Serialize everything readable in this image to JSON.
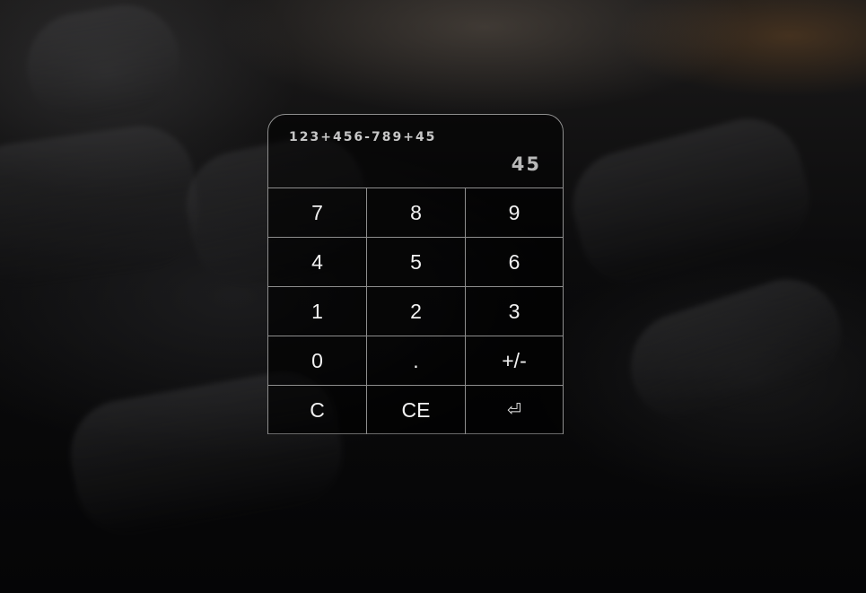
{
  "display": {
    "expression": "123+456-789+45",
    "result": "45"
  },
  "keypad": {
    "rows": [
      [
        "7",
        "8",
        "9"
      ],
      [
        "4",
        "5",
        "6"
      ],
      [
        "1",
        "2",
        "3"
      ],
      [
        "0",
        ".",
        "+/-"
      ],
      [
        "C",
        "CE",
        "⏎"
      ]
    ]
  },
  "icons": {
    "enter": "enter-return-icon"
  },
  "colors": {
    "border": "#8e8e8e",
    "text": "#f2f2f2",
    "display_text": "#c7c7c7"
  }
}
